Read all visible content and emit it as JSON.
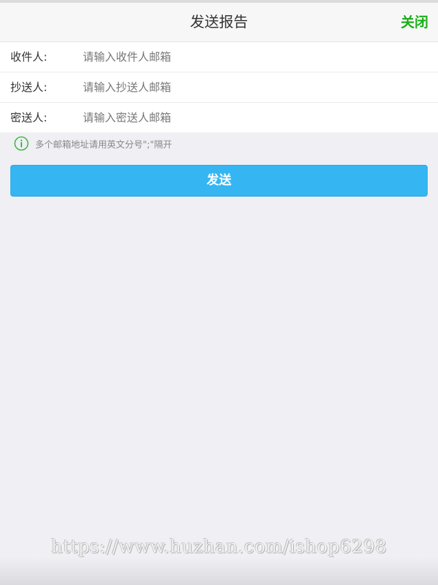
{
  "header": {
    "title": "发送报告",
    "close_label": "关闭"
  },
  "form": {
    "rows": [
      {
        "label": "收件人:",
        "placeholder": "请输入收件人邮箱",
        "value": ""
      },
      {
        "label": "抄送人:",
        "placeholder": "请输入抄送人邮箱",
        "value": ""
      },
      {
        "label": "密送人:",
        "placeholder": "请输入密送人邮箱",
        "value": ""
      }
    ]
  },
  "hint": {
    "icon": "info-icon",
    "text": "多个邮箱地址请用英文分号\";\"隔开"
  },
  "send_button": {
    "label": "发送"
  },
  "watermark": {
    "text": "https://www.huzhan.com/ishop6298"
  },
  "colors": {
    "accent_green": "#1aad19",
    "button_blue": "#35b6f3",
    "background": "#efeff4"
  }
}
